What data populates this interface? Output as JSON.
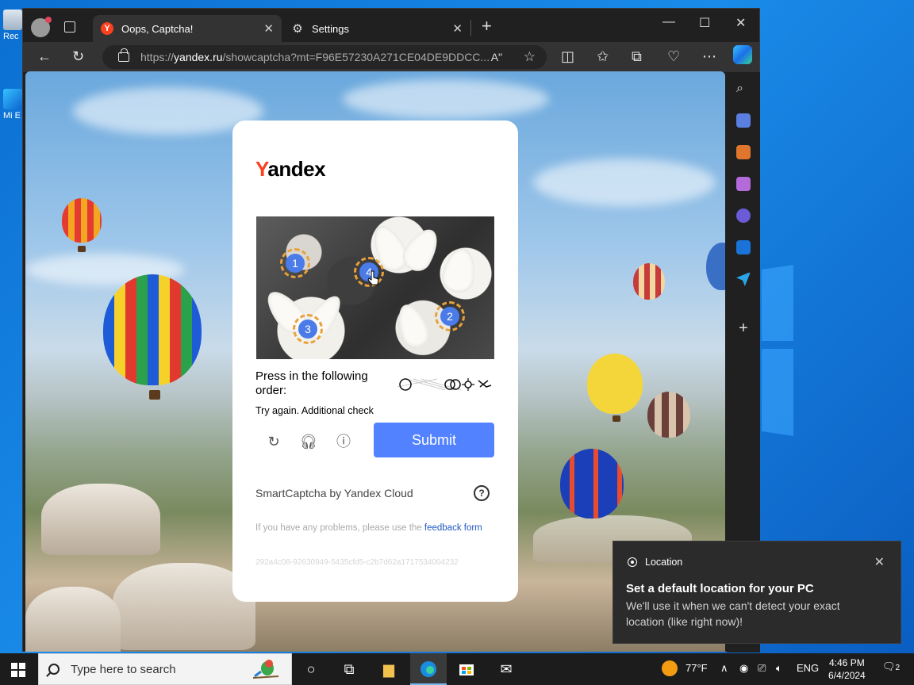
{
  "desktop": {
    "icons": [
      {
        "label": "Rec"
      },
      {
        "label": "Mi\nE"
      }
    ]
  },
  "browser": {
    "tabs": [
      {
        "title": "Oops, Captcha!",
        "icon": "yandex-favicon",
        "active": true
      },
      {
        "title": "Settings",
        "icon": "gear-icon",
        "active": false
      }
    ],
    "address": {
      "scheme": "https://",
      "host": "yandex.ru",
      "path": "/showcaptcha?mt=F96E57230A271CE04DE9DDCC..."
    },
    "reader_label": "Aʺ"
  },
  "captcha": {
    "logo_y": "Y",
    "logo_rest": "andex",
    "markers": [
      "1",
      "4",
      "3",
      "2"
    ],
    "prompt": "Press in the following order:",
    "status": "Try again. Additional check",
    "submit_label": "Submit",
    "provider": "SmartCaptcha by Yandex Cloud",
    "help_symbol": "?",
    "problems_text": "If you have any problems, please use the ",
    "feedback_link": "feedback form",
    "request_id": "292a4c08-92630949-5435cfd5-c2b7d62a1717534004232"
  },
  "notification": {
    "app": "Location",
    "title": "Set a default location for your PC",
    "body": "We'll use it when we can't detect your exact location (like right now)!"
  },
  "taskbar": {
    "search_placeholder": "Type here to search",
    "weather": "77°F",
    "language": "ENG",
    "time": "4:46 PM",
    "date": "6/4/2024",
    "notification_count": "2"
  },
  "colors": {
    "submit": "#5282ff",
    "yandex_red": "#fc3f1d",
    "marker": "#4b7be8"
  }
}
